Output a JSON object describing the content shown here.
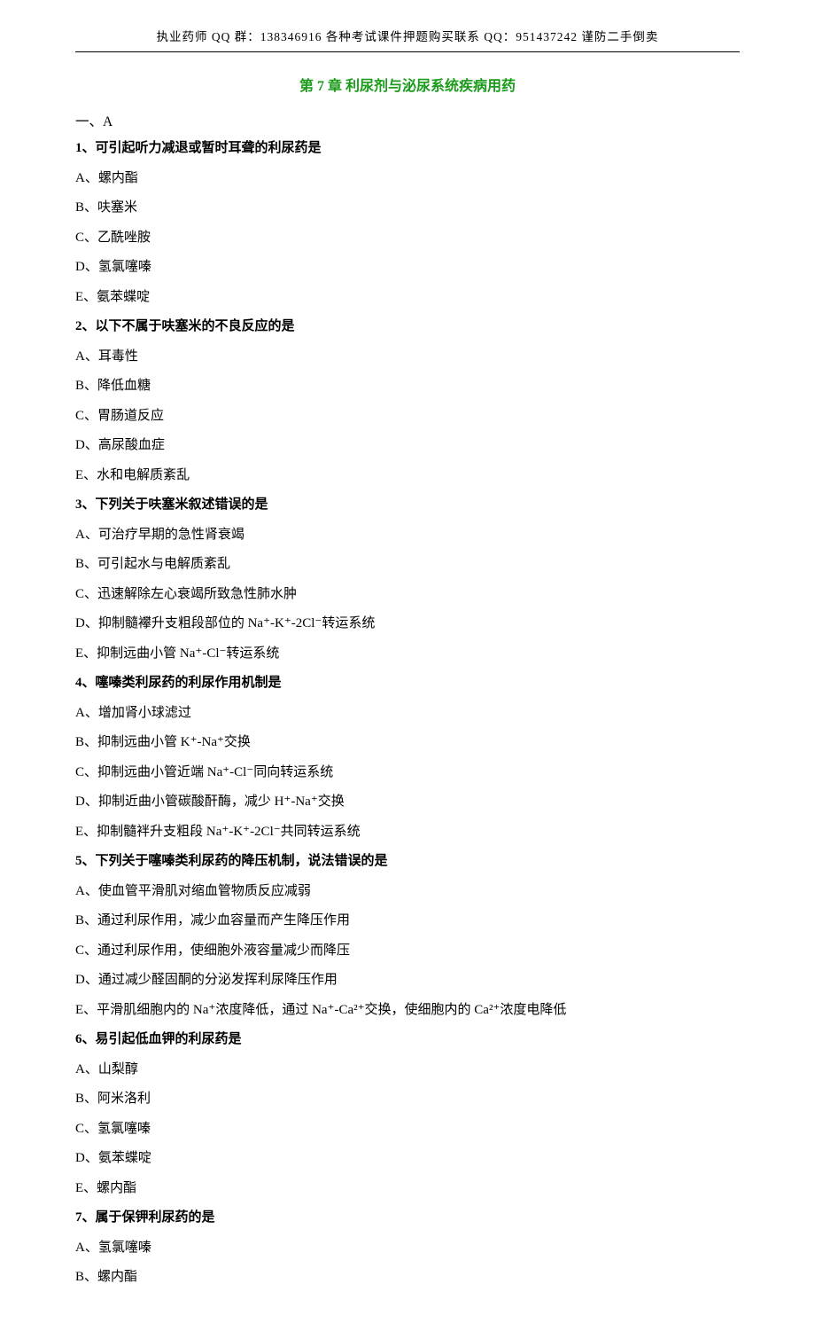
{
  "header": "执业药师 QQ 群：138346916  各种考试课件押题购买联系 QQ：951437242 谨防二手倒卖",
  "chapter_title": "第 7 章 利尿剂与泌尿系统疾病用药",
  "section_label": "一、A",
  "questions": [
    {
      "stem": "1、可引起听力减退或暂时耳聋的利尿药是",
      "options": [
        "A、螺内酯",
        "B、呋塞米",
        "C、乙酰唑胺",
        "D、氢氯噻嗪",
        "E、氨苯蝶啶"
      ]
    },
    {
      "stem": "2、以下不属于呋塞米的不良反应的是",
      "options": [
        "A、耳毒性",
        "B、降低血糖",
        "C、胃肠道反应",
        "D、高尿酸血症",
        "E、水和电解质紊乱"
      ]
    },
    {
      "stem": "3、下列关于呋塞米叙述错误的是",
      "options": [
        "A、可治疗早期的急性肾衰竭",
        "B、可引起水与电解质紊乱",
        "C、迅速解除左心衰竭所致急性肺水肿",
        "D、抑制髓襻升支粗段部位的 Na⁺-K⁺-2Cl⁻转运系统",
        "E、抑制远曲小管 Na⁺-Cl⁻转运系统"
      ]
    },
    {
      "stem": "4、噻嗪类利尿药的利尿作用机制是",
      "options": [
        "A、增加肾小球滤过",
        "B、抑制远曲小管 K⁺-Na⁺交换",
        "C、抑制远曲小管近端 Na⁺-Cl⁻同向转运系统",
        "D、抑制近曲小管碳酸酐酶，减少 H⁺-Na⁺交换",
        "E、抑制髓袢升支粗段 Na⁺-K⁺-2Cl⁻共同转运系统"
      ]
    },
    {
      "stem": "5、下列关于噻嗪类利尿药的降压机制，说法错误的是",
      "options": [
        "A、使血管平滑肌对缩血管物质反应减弱",
        "B、通过利尿作用，减少血容量而产生降压作用",
        "C、通过利尿作用，使细胞外液容量减少而降压",
        "D、通过减少醛固酮的分泌发挥利尿降压作用",
        "E、平滑肌细胞内的 Na⁺浓度降低，通过 Na⁺-Ca²⁺交换，使细胞内的 Ca²⁺浓度电降低"
      ]
    },
    {
      "stem": "6、易引起低血钾的利尿药是",
      "options": [
        "A、山梨醇",
        "B、阿米洛利",
        "C、氢氯噻嗪",
        "D、氨苯蝶啶",
        "E、螺内酯"
      ]
    },
    {
      "stem": "7、属于保钾利尿药的是",
      "options": [
        "A、氢氯噻嗪",
        "B、螺内酯"
      ]
    }
  ]
}
